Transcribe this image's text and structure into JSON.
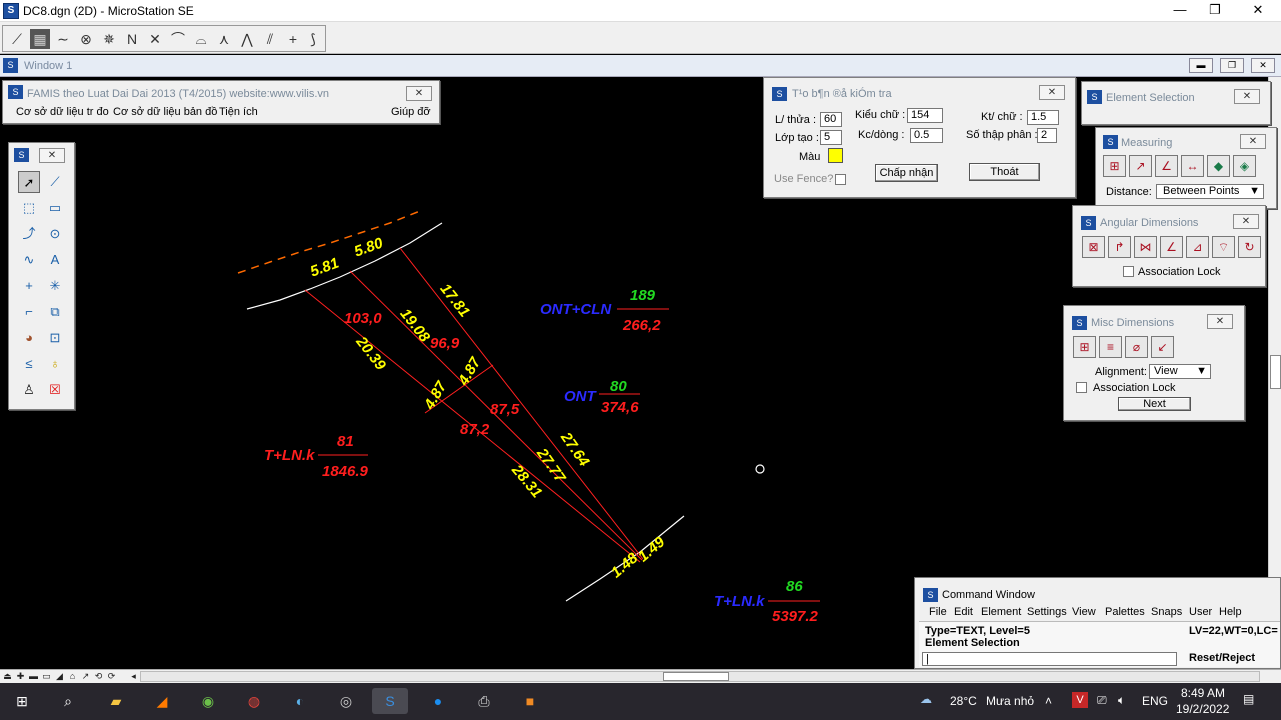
{
  "app": {
    "title": "DC8.dgn (2D) - MicroStation SE",
    "minimize": "—",
    "maximize": "❐",
    "close": "✕"
  },
  "window1": {
    "title": "Window 1"
  },
  "famis": {
    "title": "FAMIS theo Luat Dai Dai 2013 (T4/2015)  website:www.vilis.vn",
    "menu": [
      "Cơ sở dữ liệu tr đo",
      "Cơ sở dữ liệu bản đồ",
      "Tiện ích",
      "Giúp đỡ"
    ]
  },
  "tao_bando": {
    "title": "T¹o b¶n ®å kiÓm tra",
    "lthua_label": "L/ thửa :",
    "lthua_value": "60",
    "loptao_label": "Lớp tạo :",
    "loptao_value": "5",
    "mau_label": "Màu",
    "usefence_label": "Use Fence?",
    "kieuchu_label": "Kiểu chữ :",
    "kieuchu_value": "154",
    "kcdong_label": "Kc/dòng :",
    "kcdong_value": "0.5",
    "ktchu_label": "Kt/ chữ :",
    "ktchu_value": "1.5",
    "sothapphan_label": "Số thập phân :",
    "sothapphan_value": "2",
    "accept_label": "Chấp nhận",
    "exit_label": "Thoát",
    "color_swatch": "#ffff00"
  },
  "element_selection": {
    "title": "Element Selection"
  },
  "measuring": {
    "title": "Measuring",
    "distance_label": "Distance:",
    "distance_value": "Between Points"
  },
  "angular": {
    "title": "Angular Dimensions",
    "assoc_label": "Association Lock"
  },
  "misc": {
    "title": "Misc Dimensions",
    "alignment_label": "Alignment:",
    "alignment_value": "View",
    "assoc_label": "Association Lock",
    "next_label": "Next"
  },
  "command": {
    "title": "Command Window",
    "menu": [
      "File",
      "Edit",
      "Element",
      "Settings",
      "View",
      "Palettes",
      "Snaps",
      "User",
      "Help"
    ],
    "line1": "Type=TEXT, Level=5",
    "line1_right": "LV=22,WT=0,LC=",
    "line2": "Element Selection",
    "reset_label": "Reset/Reject",
    "input_value": "|"
  },
  "drawing": {
    "labels": [
      {
        "text": "5.81",
        "color": "yel"
      },
      {
        "text": "5.80",
        "color": "yel"
      },
      {
        "text": "17.81",
        "color": "yel"
      },
      {
        "text": "103,0",
        "color": "red"
      },
      {
        "text": "19.08",
        "color": "yel"
      },
      {
        "text": "96,9",
        "color": "red"
      },
      {
        "text": "20.39",
        "color": "yel"
      },
      {
        "text": "4.87",
        "color": "yel"
      },
      {
        "text": "4.87",
        "color": "yel"
      },
      {
        "text": "87,5",
        "color": "red"
      },
      {
        "text": "87,2",
        "color": "red"
      },
      {
        "text": "27.64",
        "color": "yel"
      },
      {
        "text": "27.77",
        "color": "yel"
      },
      {
        "text": "28.31",
        "color": "yel"
      },
      {
        "text": "1.48",
        "color": "yel"
      },
      {
        "text": "1.49",
        "color": "yel"
      },
      {
        "text": "ONT+CLN",
        "color": "blu"
      },
      {
        "text": "189",
        "color": "grn"
      },
      {
        "text": "266,2",
        "color": "red"
      },
      {
        "text": "ONT",
        "color": "blu"
      },
      {
        "text": "80",
        "color": "grn"
      },
      {
        "text": "374,6",
        "color": "red"
      },
      {
        "text": "T+LN.k",
        "color": "red"
      },
      {
        "text": "81",
        "color": "red"
      },
      {
        "text": "1846.9",
        "color": "red"
      },
      {
        "text": "T+LN.k",
        "color": "blu"
      },
      {
        "text": "86",
        "color": "grn"
      },
      {
        "text": "5397.2",
        "color": "red"
      }
    ]
  },
  "taskbar": {
    "weather": "28°C",
    "weather_text": "Mưa nhỏ",
    "lang": "ENG",
    "time": "8:49 AM",
    "date": "19/2/2022",
    "tray_v": "V"
  }
}
